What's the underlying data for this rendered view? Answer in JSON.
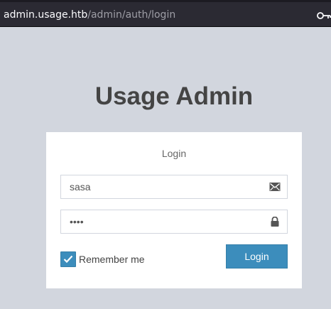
{
  "browser": {
    "url_host": "admin.usage.htb",
    "url_path": "/admin/auth/login",
    "key_icon": "key-icon"
  },
  "page": {
    "title": "Usage Admin"
  },
  "login_box": {
    "heading": "Login",
    "username": {
      "value": "sasa",
      "icon": "envelope-icon"
    },
    "password": {
      "value": "••••",
      "icon": "lock-icon"
    },
    "remember": {
      "label": "Remember me",
      "checked": true
    },
    "submit_label": "Login"
  },
  "colors": {
    "background": "#d2d6de",
    "accent": "#3c8dbc",
    "title": "#444444"
  }
}
